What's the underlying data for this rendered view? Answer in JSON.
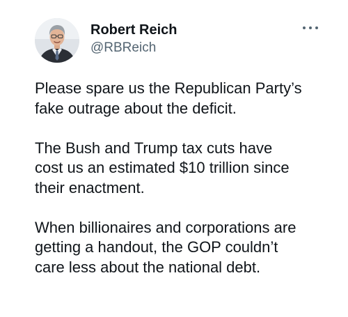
{
  "author": {
    "display_name": "Robert Reich",
    "handle": "@RBReich",
    "avatar_icon": "profile-photo"
  },
  "menu": {
    "icon": "more-options-icon"
  },
  "tweet": {
    "paragraphs": [
      "Please spare us the Republican Party’s\nfake outrage about the deficit.",
      "The Bush and Trump tax cuts have\ncost us an estimated $10 trillion since\ntheir enactment.",
      "When billionaires and corporations are\ngetting a handout, the GOP couldn’t\ncare less about the national debt."
    ]
  },
  "colors": {
    "text": "#0f1419",
    "secondary": "#536471",
    "background": "#ffffff"
  }
}
